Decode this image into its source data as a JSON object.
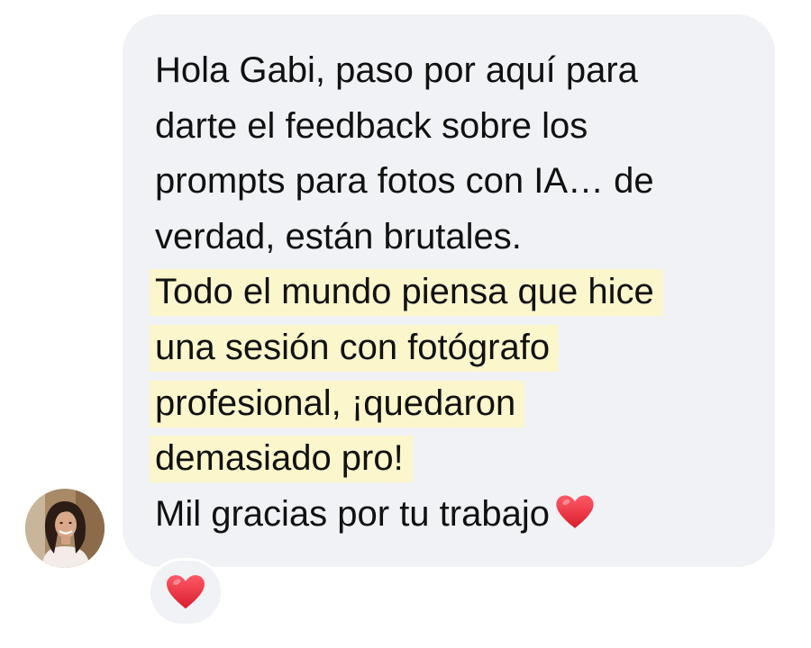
{
  "message": {
    "lines": [
      "Hola Gabi, paso por aquí para",
      "darte el feedback sobre los",
      "prompts para fotos con IA… de",
      "verdad, están brutales."
    ],
    "highlighted_lines": [
      "Todo el mundo piensa que hice",
      "una sesión con fotógrafo",
      "profesional, ¡quedaron",
      "demasiado pro!"
    ],
    "closing_line": "Mil gracias por tu trabajo",
    "closing_emoji": "red-heart-icon"
  },
  "reaction": {
    "emoji": "red-heart-icon"
  },
  "colors": {
    "bubble_background": "#f0f2f5",
    "highlight": "#fbf6cc",
    "text": "#111111",
    "heart": "#e02b3a"
  }
}
